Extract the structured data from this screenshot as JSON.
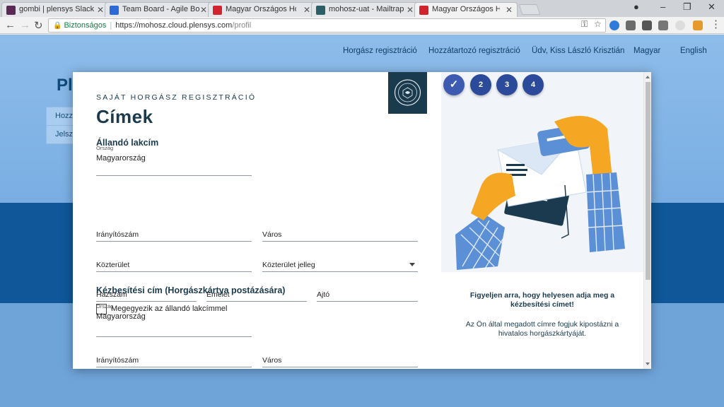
{
  "browser": {
    "tabs": [
      {
        "title": "gombi | plensys Slack",
        "active": false,
        "favicon_color": "#5a2a55"
      },
      {
        "title": "Team Board - Agile Board",
        "active": false,
        "favicon_color": "#2d6ad6"
      },
      {
        "title": "Magyar Országos Horgász",
        "active": false,
        "favicon_color": "#d2232f"
      },
      {
        "title": "mohosz-uat - Mailtrap",
        "active": false,
        "favicon_color": "#2b5f67"
      },
      {
        "title": "Magyar Országos Horgász",
        "active": true,
        "favicon_color": "#d2232f"
      }
    ],
    "secure_label": "Biztonságos",
    "url_host": "https://mohosz.cloud.plensys.com",
    "url_path": "/profil"
  },
  "site": {
    "nav": [
      "Horgász regisztráció",
      "Hozzátartozó regisztráció",
      "Üdv, Kiss László Krisztián",
      "Magyar",
      "English"
    ],
    "logo_partial": "Pl",
    "menu_partial": [
      "Hozz",
      "Jelsz"
    ]
  },
  "modal": {
    "eyebrow": "SAJÁT HORGÁSZ REGISZTRÁCIÓ",
    "title": "Címek",
    "permanent": {
      "heading": "Állandó lakcím",
      "country_label": "Ország",
      "country_value": "Magyarország",
      "zip": "Irányítószám",
      "city": "Város",
      "street": "Közterület",
      "street_type": "Közterület jelleg",
      "house": "Házszám",
      "floor": "Emelet",
      "door": "Ajtó"
    },
    "delivery": {
      "heading": "Kézbesítési cím (Horgászkártya postázására)",
      "same_checkbox": "Megegyezik az állandó lakcímmel",
      "country_label": "Ország",
      "country_value": "Magyarország",
      "zip": "Irányítószám",
      "city": "Város"
    },
    "steps": [
      "✓",
      "2",
      "3",
      "4"
    ],
    "note_bold": "Figyeljen arra, hogy helyesen adja meg a kézbesítési címet!",
    "note": "Az Ön által megadott címre fogjuk kipostázni a hivatalos horgászkártyáját."
  },
  "colors": {
    "brand_dark": "#1b3a4b",
    "step_blue": "#2c4a9a",
    "page_blue": "#0f5799",
    "illus_orange": "#f5a623",
    "illus_check": "#5b8fd6"
  },
  "icons": [
    "back-icon",
    "forward-icon",
    "reload-icon",
    "lock-icon",
    "key-icon",
    "star-icon",
    "extension-icon",
    "checkmark-icon",
    "dropdown-caret-icon",
    "envelope-illustration"
  ]
}
